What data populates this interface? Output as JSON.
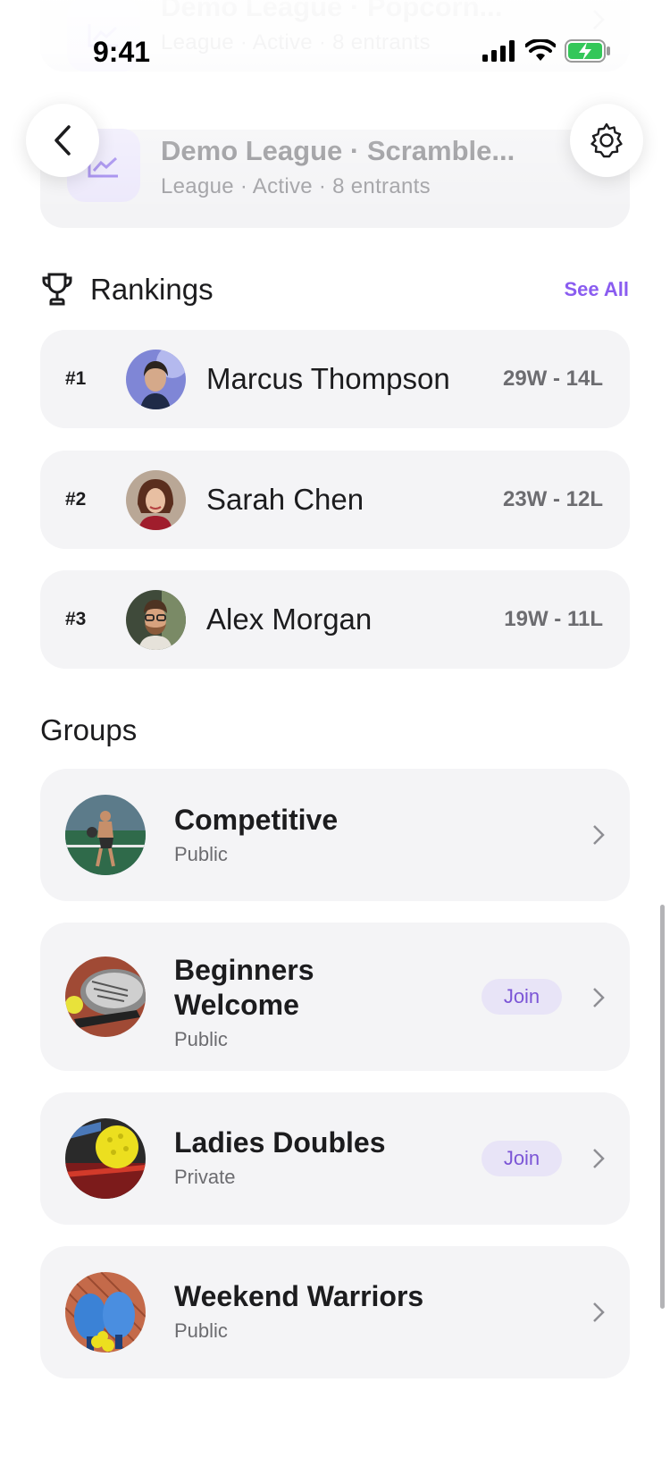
{
  "status_bar": {
    "time": "9:41"
  },
  "leagues": [
    {
      "title": "Demo League · Popcorn...",
      "subtitle": "League · Active · 8 entrants"
    },
    {
      "title": "Demo League · Scramble...",
      "subtitle": "League · Active · 8 entrants"
    }
  ],
  "rankings": {
    "title": "Rankings",
    "see_all": "See All",
    "rows": [
      {
        "rank": "#1",
        "name": "Marcus Thompson",
        "record": "29W - 14L"
      },
      {
        "rank": "#2",
        "name": "Sarah Chen",
        "record": "23W - 12L"
      },
      {
        "rank": "#3",
        "name": "Alex Morgan",
        "record": "19W - 11L"
      }
    ]
  },
  "groups": {
    "title": "Groups",
    "items": [
      {
        "name": "Competitive",
        "visibility": "Public"
      },
      {
        "name_line1": "Beginners",
        "name_line2": "Welcome",
        "visibility": "Public",
        "action": "Join"
      },
      {
        "name": "Ladies Doubles",
        "visibility": "Private",
        "action": "Join"
      },
      {
        "name": "Weekend Warriors",
        "visibility": "Public"
      }
    ]
  },
  "colors": {
    "accent": "#8a5cf0",
    "card": "#f4f4f6",
    "join_bg": "#e8e4f7"
  }
}
